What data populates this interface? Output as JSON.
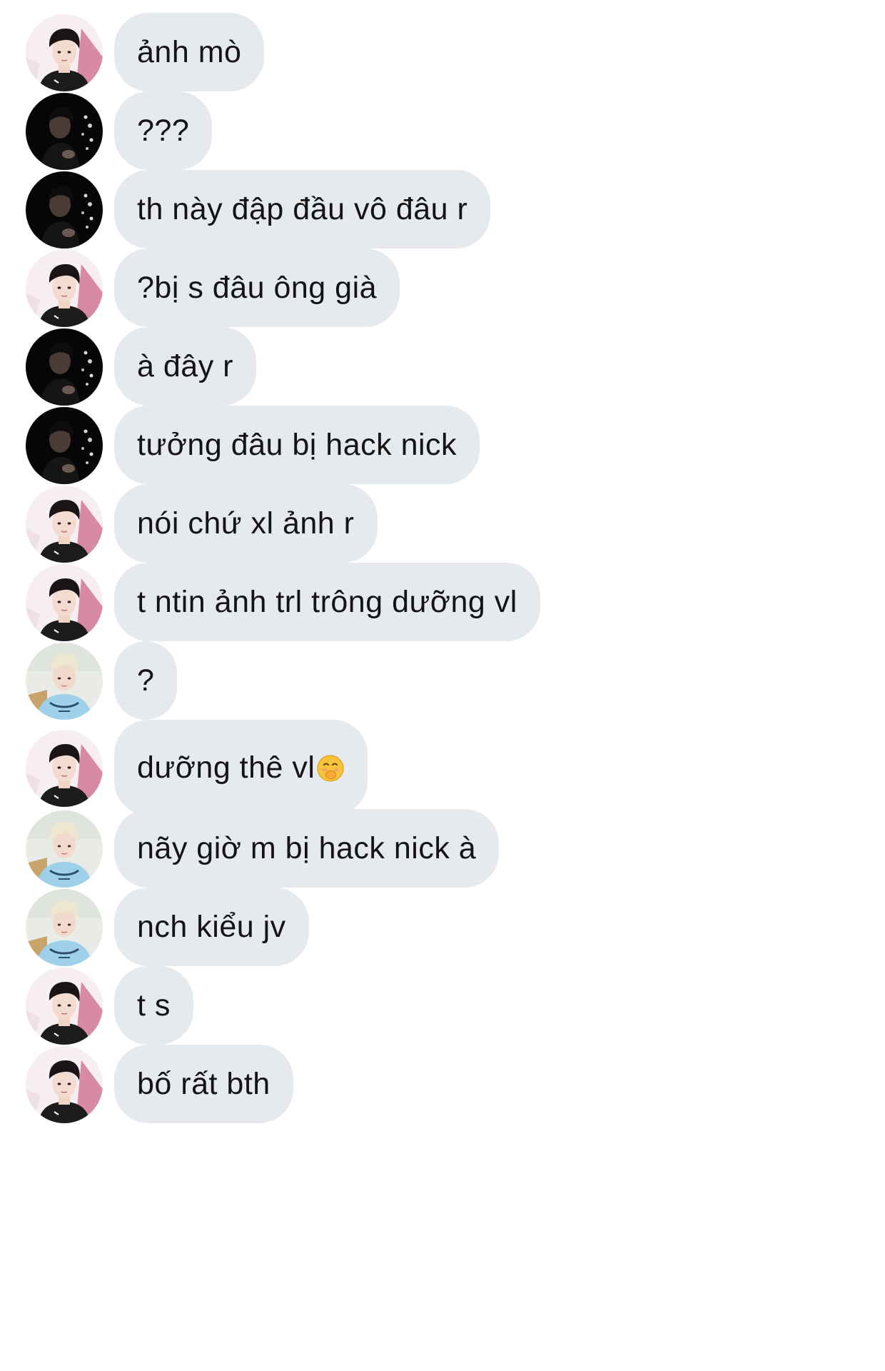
{
  "messages": [
    {
      "avatar": "avatar-boy-pink",
      "text": "ảnh mò"
    },
    {
      "avatar": "avatar-dark-photo",
      "text": "???"
    },
    {
      "avatar": "avatar-dark-photo",
      "text": "th này đập đầu vô đâu r"
    },
    {
      "avatar": "avatar-boy-pink",
      "text": "?bị s đâu ông già"
    },
    {
      "avatar": "avatar-dark-photo",
      "text": "à đây r"
    },
    {
      "avatar": "avatar-dark-photo",
      "text": "tưởng đâu bị hack nick"
    },
    {
      "avatar": "avatar-boy-pink",
      "text": "nói chứ xl ảnh r"
    },
    {
      "avatar": "avatar-boy-pink",
      "text": "t ntin ảnh trl trông dưỡng vl"
    },
    {
      "avatar": "avatar-blonde-blue",
      "text": "?"
    },
    {
      "avatar": "avatar-boy-pink",
      "text": "dưỡng thê vl",
      "emoji": "face-with-hand-over-mouth-emoji"
    },
    {
      "avatar": "avatar-blonde-blue",
      "text": "nãy giờ m bị hack nick à"
    },
    {
      "avatar": "avatar-blonde-blue",
      "text": "nch kiểu jv"
    },
    {
      "avatar": "avatar-boy-pink",
      "text": "t s"
    },
    {
      "avatar": "avatar-boy-pink",
      "text": "bố rất bth"
    }
  ],
  "colors": {
    "bubble_background": "#e6eaee",
    "text": "#141414",
    "page_background": "#ffffff"
  }
}
